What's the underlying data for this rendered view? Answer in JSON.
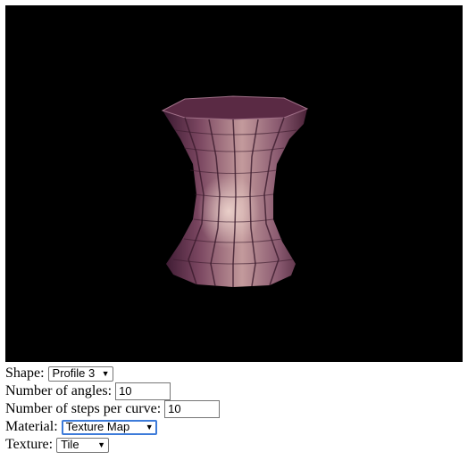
{
  "controls": {
    "shape": {
      "label": "Shape:",
      "value": "Profile 3"
    },
    "angles": {
      "label": "Number of angles:",
      "value": "10"
    },
    "steps": {
      "label": "Number of steps per curve:",
      "value": "10"
    },
    "material": {
      "label": "Material:",
      "value": "Texture Map"
    },
    "texture": {
      "label": "Texture:",
      "value": "Tile"
    }
  },
  "colors": {
    "viewport_bg": "#000000",
    "focus_border": "#3d7bd9"
  }
}
